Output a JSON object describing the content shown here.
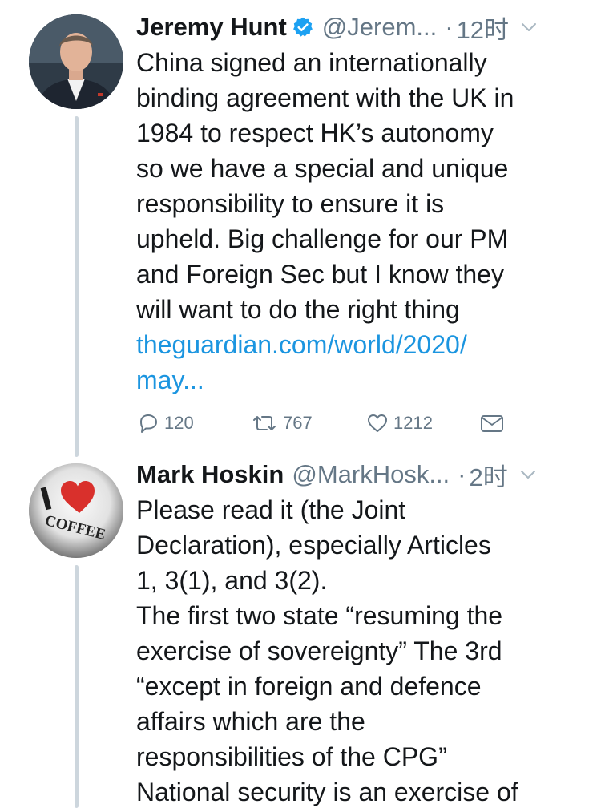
{
  "tweets": [
    {
      "name": "Jeremy Hunt",
      "verified": true,
      "handle": "@Jerem...",
      "dot": "·",
      "time": "12时",
      "lines": [
        "China signed an internationally",
        "binding agreement with the UK in",
        "1984 to respect HK’s autonomy",
        "so we have a special and unique",
        "responsibility to ensure it is",
        "upheld. Big challenge for our PM",
        "and Foreign Sec but I know they",
        "will want to do the right thing"
      ],
      "link_lines": [
        "theguardian.com/world/2020/",
        "may..."
      ],
      "actions": {
        "reply_count": "120",
        "retweet_count": "767",
        "like_count": "1212"
      }
    },
    {
      "name": "Mark Hoskin",
      "handle": "@MarkHosk...",
      "dot": "·",
      "time": "2时",
      "lines": [
        "Please read it (the Joint",
        "Declaration), especially Articles",
        "1, 3(1), and 3(2).",
        "The first two state “resuming the",
        "exercise of sovereignty” The 3rd",
        "“except in foreign and defence",
        "affairs which are the",
        "responsibilities of the CPG”",
        "National security is an exercise of"
      ],
      "avatar_text": "COFFEE"
    }
  ],
  "colors": {
    "text": "#14171a",
    "secondary": "#657786",
    "link": "#1b95e0",
    "verified": "#1da1f2",
    "thread_line": "#cdd6dd"
  },
  "icons": [
    "verified-badge-icon",
    "chevron-down-icon",
    "reply-icon",
    "retweet-icon",
    "like-icon",
    "share-icon"
  ]
}
